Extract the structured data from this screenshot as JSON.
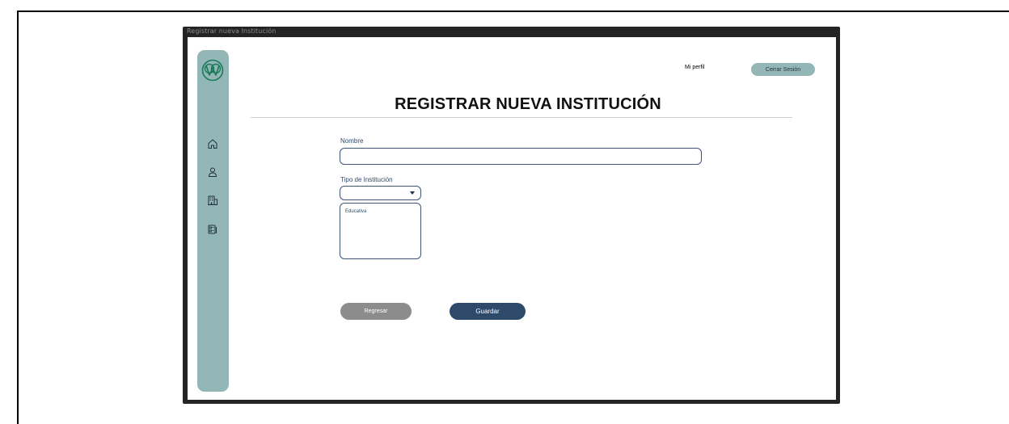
{
  "window": {
    "title": "Registrar nueva Institución"
  },
  "header": {
    "profile_label": "Mi perfil",
    "logout_label": "Cerrar Sesión"
  },
  "page": {
    "title": "REGISTRAR NUEVA INSTITUCIÓN"
  },
  "form": {
    "name_label": "Nombre",
    "name_value": "",
    "type_label": "Tipo de Institución",
    "type_value": "",
    "type_options": [
      "Educativa"
    ]
  },
  "actions": {
    "back_label": "Regresar",
    "save_label": "Guardar"
  },
  "sidebar": {
    "items": [
      {
        "icon": "home-icon"
      },
      {
        "icon": "user-icon"
      },
      {
        "icon": "building-icon"
      },
      {
        "icon": "id-card-icon"
      }
    ]
  },
  "colors": {
    "sidebar": "#93b6b7",
    "primary": "#2d4a6b",
    "secondary_button": "#8c8c8c",
    "window_chrome": "#242424"
  }
}
